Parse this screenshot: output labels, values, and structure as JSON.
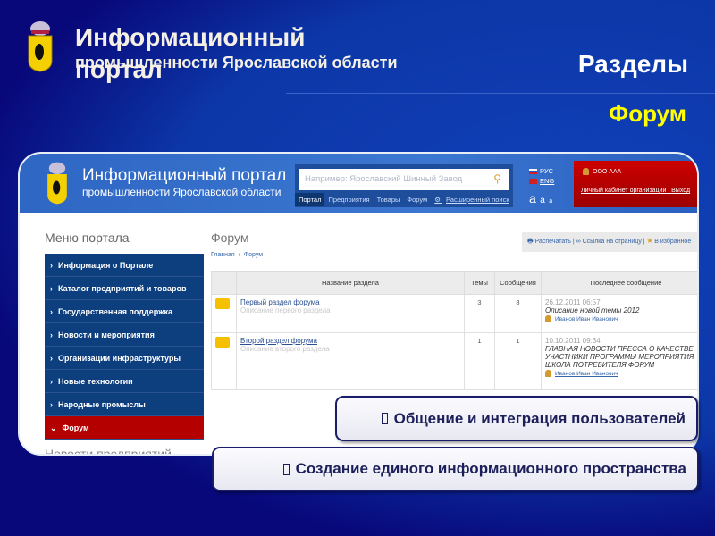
{
  "slide": {
    "title_line1": "Информационный",
    "title_line2": "промышленности Ярославской области",
    "title_line3": "портал",
    "section": "Разделы",
    "subsection": "Форум"
  },
  "portal": {
    "title": "Информационный портал",
    "subtitle": "промышленности Ярославской области",
    "search_placeholder": "Например: Ярославский Шинный Завод",
    "nav": [
      "Портал",
      "Предприятия",
      "Товары",
      "Форум"
    ],
    "advanced_search": "Расширенный поиск",
    "lang_ru": "РУС",
    "lang_en": "ENG",
    "font_sizes": [
      "a",
      "a",
      "a"
    ],
    "account_name": "ООО ААА",
    "account_link": "Личный кабинет организации",
    "logout": "Выход",
    "menu_title": "Меню портала",
    "menu": [
      "Информация о Портале",
      "Каталог предприятий и товаров",
      "Государственная поддержка",
      "Новости и мероприятия",
      "Организации инфраструктуры",
      "Новые технологии",
      "Народные промыслы",
      "Форум"
    ],
    "menu_after": "Новости предприятий",
    "page_title": "Форум",
    "tools": {
      "print": "Распечатать",
      "link": "Ссылка на страницу",
      "fav": "В избранное"
    },
    "breadcrumb": [
      "Главная",
      "Форум"
    ],
    "table": {
      "headers": [
        "Название раздела",
        "Темы",
        "Сообщения",
        "Последнее сообщение"
      ],
      "rows": [
        {
          "name": "Первый раздел форума",
          "desc": "Описание первого раздела",
          "topics": "3",
          "messages": "8",
          "date": "26.12.2011 06:57",
          "last": "Описание новой темы 2012",
          "user": "Иванов Иван Иванович"
        },
        {
          "name": "Второй раздел форума",
          "desc": "Описание второго раздела",
          "topics": "1",
          "messages": "1",
          "date": "10.10.2011 09:34",
          "last": "ГЛАВНАЯ НОВОСТИ ПРЕССА О КАЧЕСТВЕ УЧАСТНИКИ ПРОГРАММЫ МЕРОПРИЯТИЯ ШКОЛА ПОТРЕБИТЕЛЯ ФОРУМ",
          "user": "Иванов Иван Иванович"
        }
      ]
    }
  },
  "callouts": [
    "Общение и интеграция пользователей",
    "Создание единого информационного пространства"
  ],
  "colors": {
    "bg": "#08087a",
    "accent": "#ffff00",
    "menu": "#0d3e7e",
    "menu_active": "#b50000"
  }
}
